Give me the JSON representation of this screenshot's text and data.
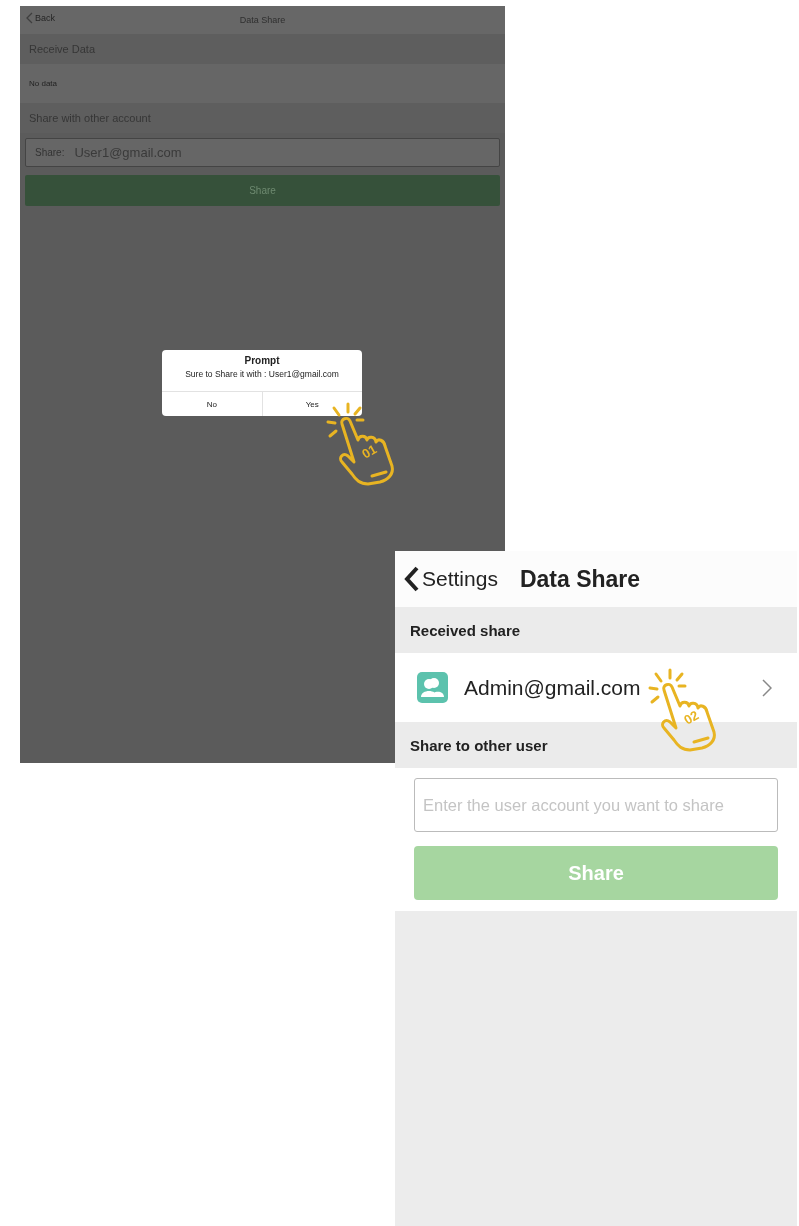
{
  "left_screen": {
    "back_label": "Back",
    "title": "Data Share",
    "receive_header": "Receive Data",
    "receive_empty": "No data",
    "share_header": "Share with other account",
    "share_field": {
      "label": "Share:",
      "value": "User1@gmail.com"
    },
    "share_button": "Share",
    "dialog": {
      "title": "Prompt",
      "message": "Sure to Share it with : User1@gmail.com",
      "buttons": [
        {
          "label": "No"
        },
        {
          "label": "Yes"
        }
      ]
    },
    "step": "01"
  },
  "right_screen": {
    "back_label": "Settings",
    "title": "Data Share",
    "received_header": "Received share",
    "received_items": [
      {
        "account": "Admin@gmail.com"
      }
    ],
    "share_header": "Share to other user",
    "share_field": {
      "placeholder": "Enter the user account you want to share"
    },
    "share_button": {
      "label": "Share",
      "disabled": true
    },
    "step": "02"
  }
}
